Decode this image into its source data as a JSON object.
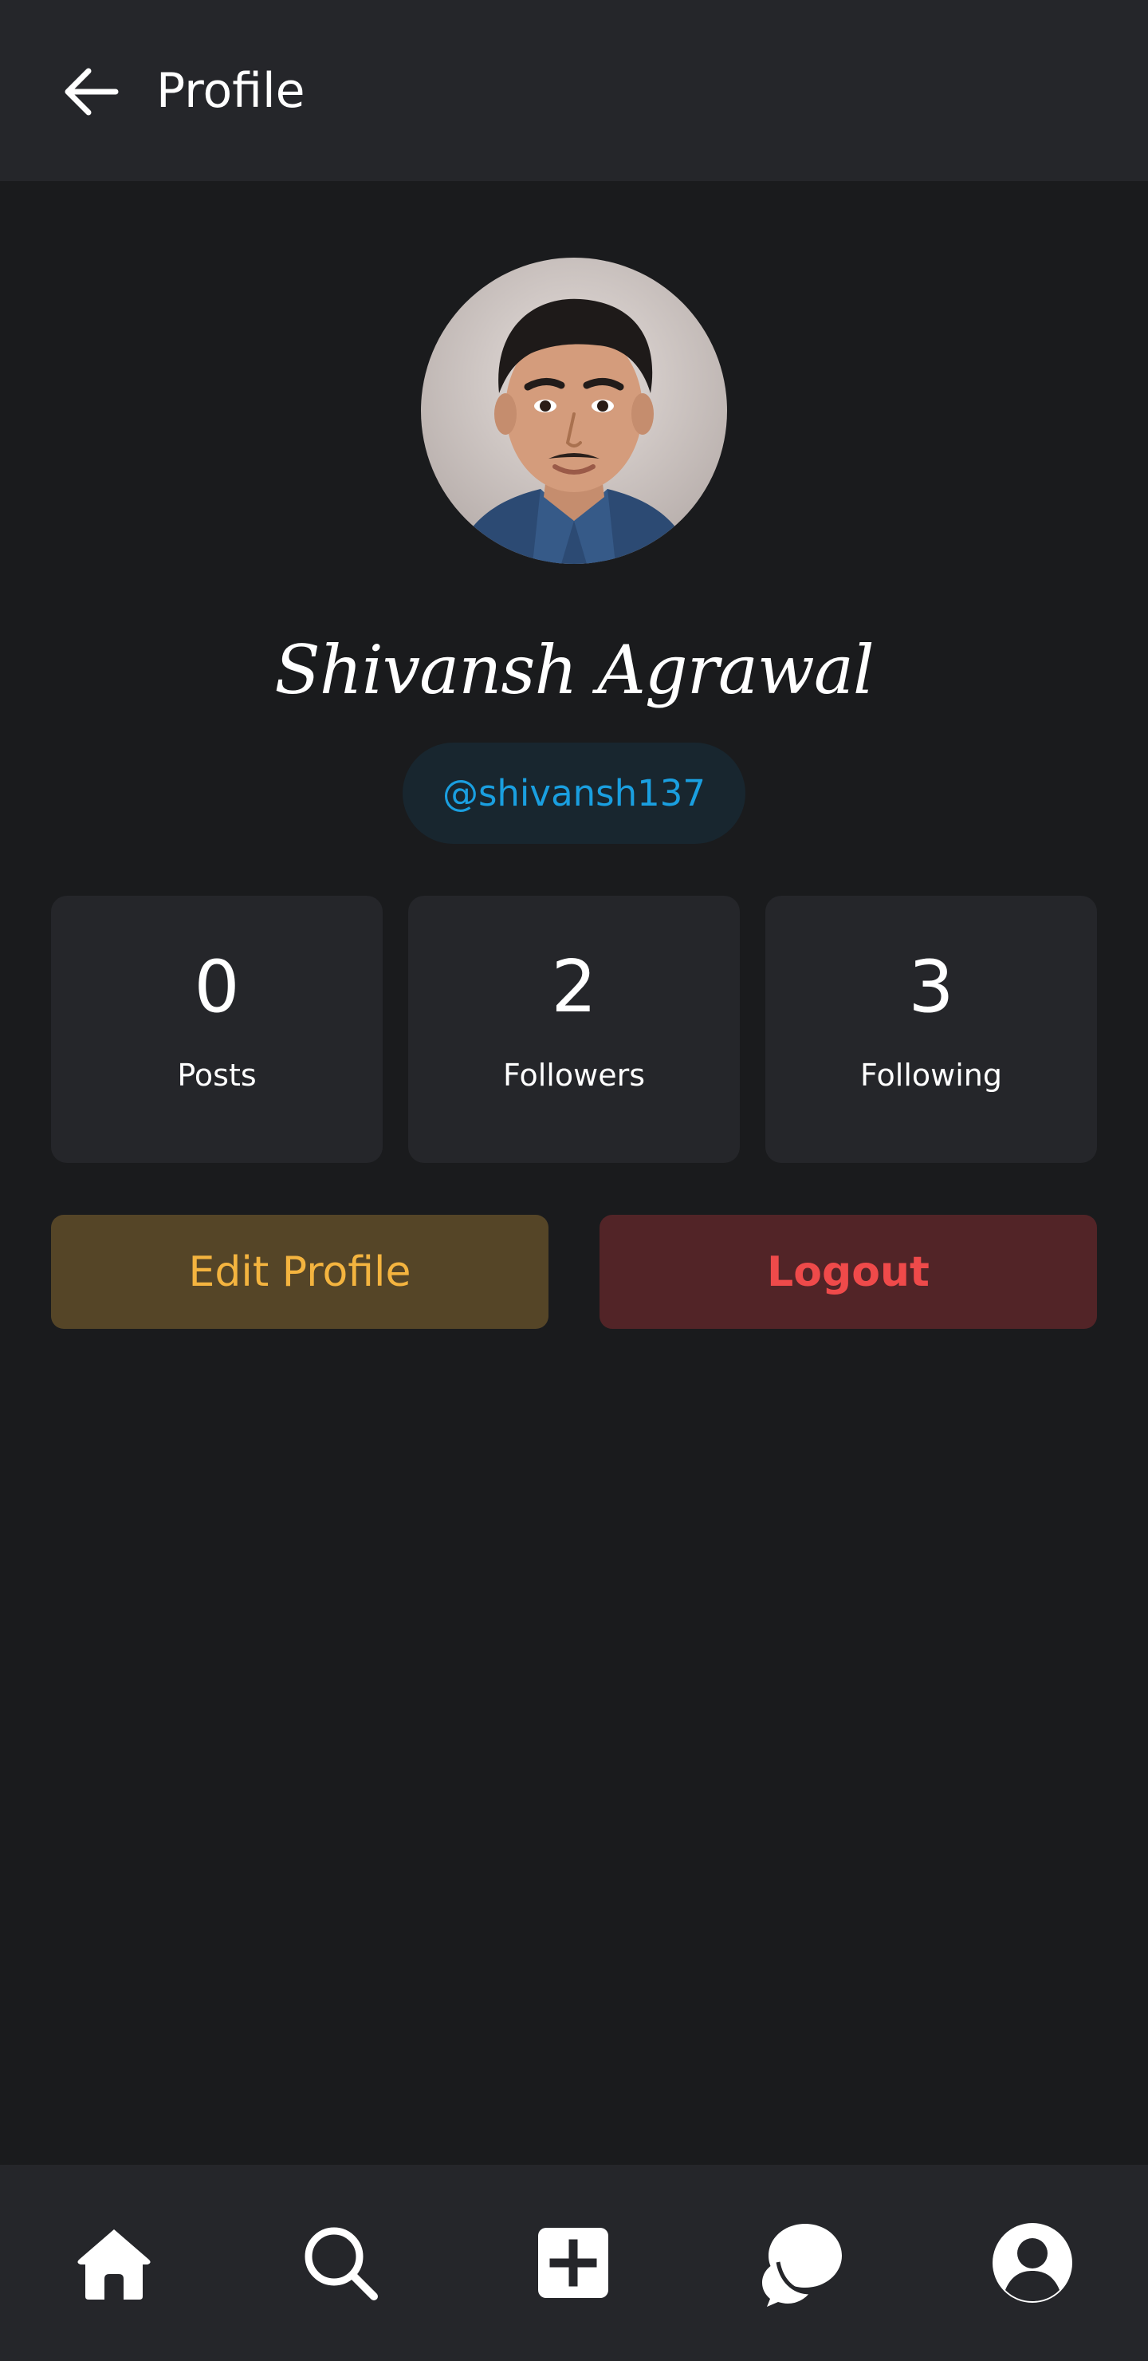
{
  "header": {
    "back_icon": "arrow-left-icon",
    "title": "Profile"
  },
  "profile": {
    "display_name": "Shivansh Agrawal",
    "handle": "@shivansh137",
    "avatar_alt": "Profile photo"
  },
  "stats": [
    {
      "value": "0",
      "label": "Posts"
    },
    {
      "value": "2",
      "label": "Followers"
    },
    {
      "value": "3",
      "label": "Following"
    }
  ],
  "actions": {
    "edit_label": "Edit Profile",
    "logout_label": "Logout"
  },
  "bottom_nav": [
    {
      "icon": "home-icon"
    },
    {
      "icon": "search-icon"
    },
    {
      "icon": "add-post-icon"
    },
    {
      "icon": "chat-icon"
    },
    {
      "icon": "profile-icon"
    }
  ],
  "colors": {
    "background": "#1a1b1d",
    "surface": "#25262a",
    "handle_accent": "#1a9fe0",
    "edit_accent": "#f4b43f",
    "logout_accent": "#ef4a4a"
  }
}
